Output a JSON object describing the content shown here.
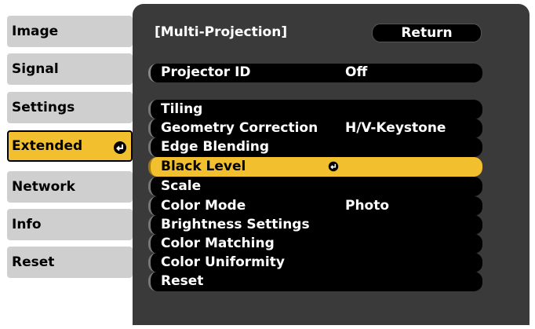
{
  "tabs": [
    {
      "label": "Image",
      "selected": false
    },
    {
      "label": "Signal",
      "selected": false
    },
    {
      "label": "Settings",
      "selected": false
    },
    {
      "label": "Extended",
      "selected": true
    },
    {
      "label": "Network",
      "selected": false
    },
    {
      "label": "Info",
      "selected": false
    },
    {
      "label": "Reset",
      "selected": false
    }
  ],
  "header": {
    "title": "[Multi-Projection]",
    "return_label": "Return"
  },
  "projector_id": {
    "label": "Projector ID",
    "value": "Off"
  },
  "menu": [
    {
      "label": "Tiling",
      "value": ""
    },
    {
      "label": "Geometry Correction",
      "value": "H/V-Keystone"
    },
    {
      "label": "Edge Blending",
      "value": ""
    },
    {
      "label": "Black Level",
      "value": "",
      "selected": true
    },
    {
      "label": "Scale",
      "value": ""
    },
    {
      "label": "Color Mode",
      "value": "Photo"
    },
    {
      "label": "Brightness Settings",
      "value": ""
    },
    {
      "label": "Color Matching",
      "value": ""
    },
    {
      "label": "Color Uniformity",
      "value": ""
    },
    {
      "label": "Reset",
      "value": ""
    }
  ],
  "colors": {
    "accent": "#f2c02f",
    "panel": "#3a3a3a",
    "tab": "#cfcfcf"
  }
}
